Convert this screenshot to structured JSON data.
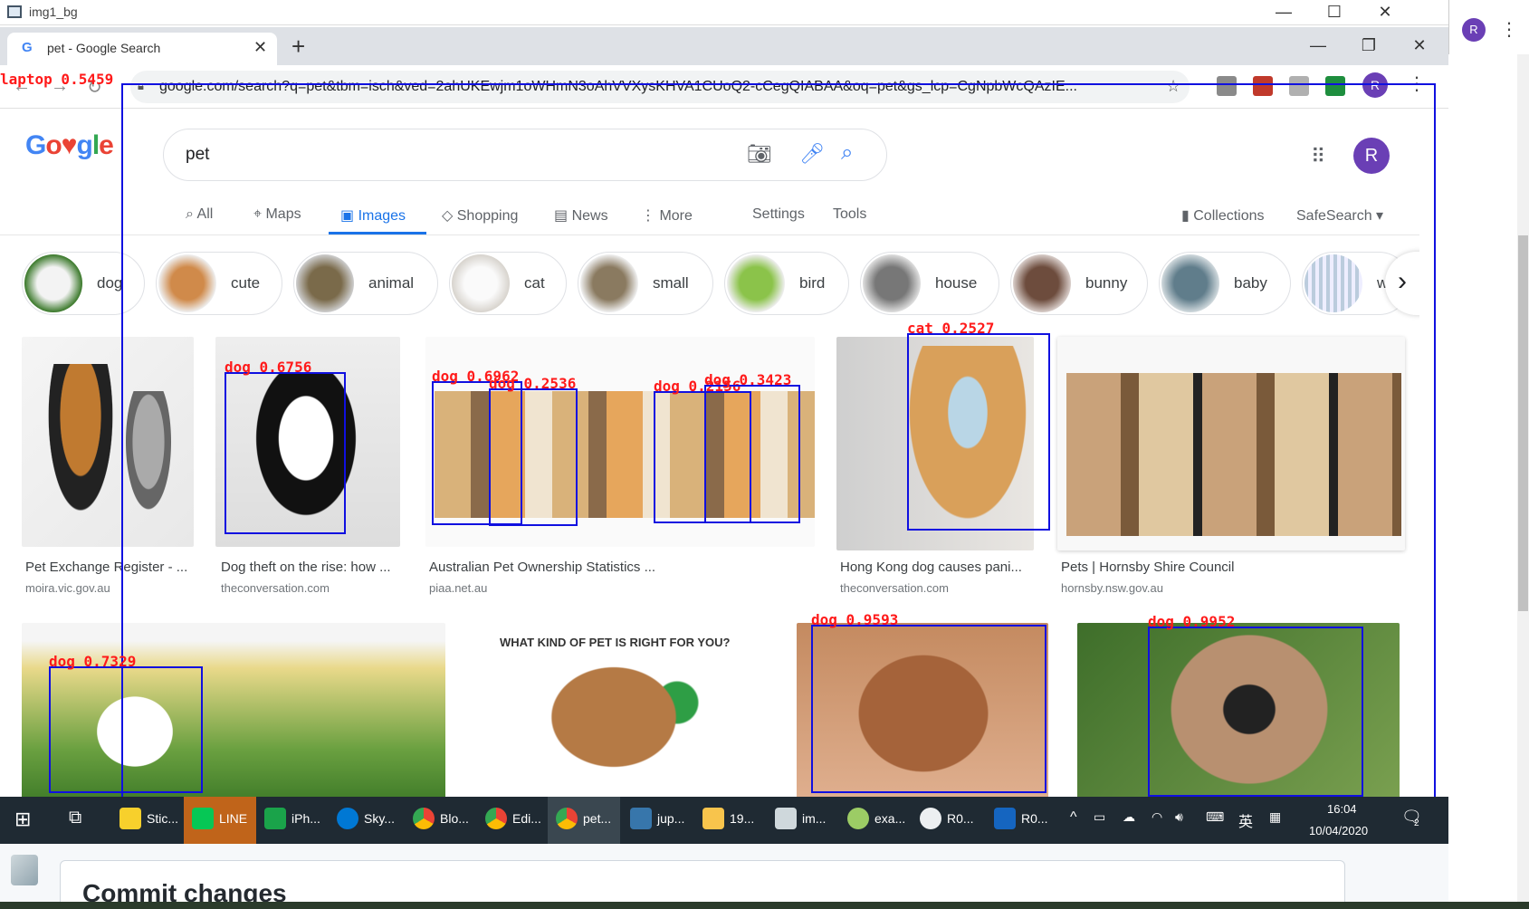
{
  "viewer": {
    "title": "img1_bg"
  },
  "browser": {
    "tab_title": "pet - Google Search",
    "url": "google.com/search?q=pet&tbm=isch&ved=2ahUKEwjm1oWHmN3oAhVVXysKHVA1CUoQ2-cCegQIABAA&oq=pet&gs_lcp=CgNpbWcQAzIE...",
    "profile_initial": "R"
  },
  "search": {
    "query": "pet",
    "avatar_initial": "R"
  },
  "nav": {
    "all": "All",
    "maps": "Maps",
    "images": "Images",
    "shopping": "Shopping",
    "news": "News",
    "more": "More",
    "settings": "Settings",
    "tools": "Tools",
    "collections": "Collections",
    "safesearch": "SafeSearch"
  },
  "chips": [
    "dog",
    "cute",
    "animal",
    "cat",
    "small",
    "bird",
    "house",
    "bunny",
    "baby",
    "w"
  ],
  "results_row1": [
    {
      "caption": "Pet Exchange Register - ...",
      "source": "moira.vic.gov.au"
    },
    {
      "caption": "Dog theft on the rise: how ...",
      "source": "theconversation.com"
    },
    {
      "caption": "Australian Pet Ownership Statistics ...",
      "source": "piaa.net.au"
    },
    {
      "caption": "Hong Kong dog causes pani...",
      "source": "theconversation.com"
    },
    {
      "caption": "Pets | Hornsby Shire Council",
      "source": "hornsby.nsw.gov.au"
    }
  ],
  "result_row2_text": "WHAT KIND OF PET IS RIGHT FOR YOU?",
  "detections": [
    {
      "label": "laptop 0.5459"
    },
    {
      "label": "dog 0.6756"
    },
    {
      "label": "dog 0.6962"
    },
    {
      "label": "dog 0.2536"
    },
    {
      "label": "dog 0.2156"
    },
    {
      "label": "dog 0.3423"
    },
    {
      "label": "cat 0.2527"
    },
    {
      "label": "dog 0.7329"
    },
    {
      "label": "dog 0.9593"
    },
    {
      "label": "dog 0.9952"
    }
  ],
  "taskbar": {
    "items": [
      "Stic...",
      "LINE",
      "iPh...",
      "Sky...",
      "Blo...",
      "Edi...",
      "pet...",
      "jup...",
      "19...",
      "im...",
      "exa...",
      "R0...",
      "R0..."
    ],
    "time": "16:04",
    "date": "10/04/2020",
    "ime": "英",
    "notifications": "2"
  },
  "background_page": {
    "heading": "Commit changes"
  },
  "colors": {
    "bbox": "#1010e0",
    "label": "#ff1a1a",
    "accent": "#1a73e8",
    "avatar": "#6a3fb5"
  }
}
